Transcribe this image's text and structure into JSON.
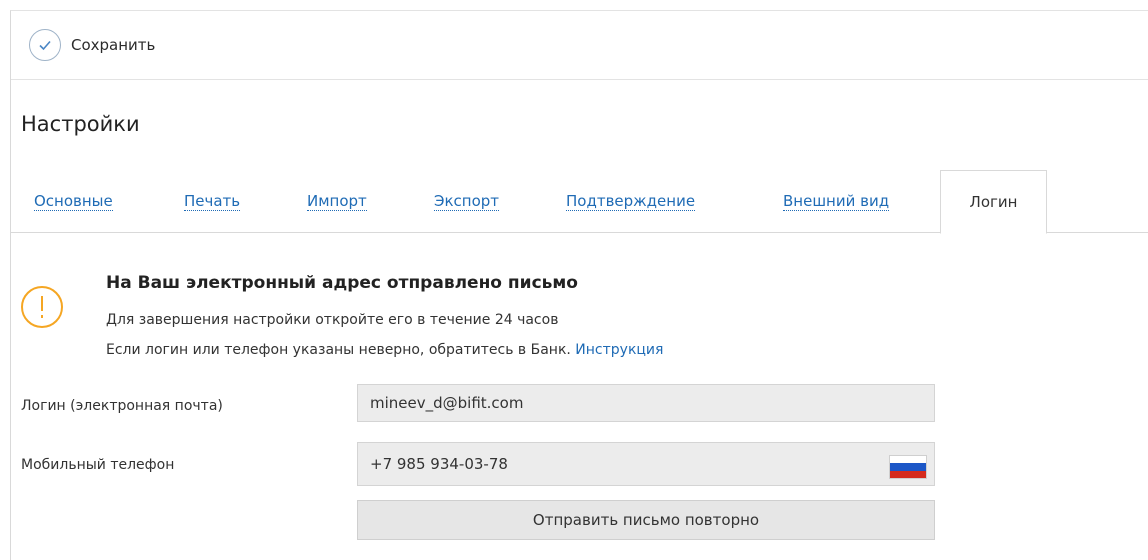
{
  "toolbar": {
    "save_label": "Сохранить",
    "save_icon": "check-circle-icon"
  },
  "page": {
    "title": "Настройки"
  },
  "tabs": [
    {
      "label": "Основные",
      "active": false
    },
    {
      "label": "Печать",
      "active": false
    },
    {
      "label": "Импорт",
      "active": false
    },
    {
      "label": "Экспорт",
      "active": false
    },
    {
      "label": "Подтверждение",
      "active": false
    },
    {
      "label": "Внешний вид",
      "active": false
    },
    {
      "label": "Логин",
      "active": true
    }
  ],
  "notice": {
    "icon": "warning-icon",
    "title": "На Ваш электронный адрес отправлено письмо",
    "line1": "Для завершения настройки откройте его в течение 24 часов",
    "line2": "Если логин или телефон указаны неверно, обратитесь в Банк.",
    "link": "Инструкция"
  },
  "form": {
    "login_label": "Логин (электронная почта)",
    "login_value": "mineev_d@bifit.com",
    "phone_label": "Мобильный телефон",
    "phone_value": "+7 985 934-03-78",
    "phone_flag": "russia-flag-icon",
    "resend_label": "Отправить письмо повторно"
  },
  "colors": {
    "link": "#1f6bb5",
    "warning": "#f5a623",
    "field_bg": "#ececec"
  }
}
